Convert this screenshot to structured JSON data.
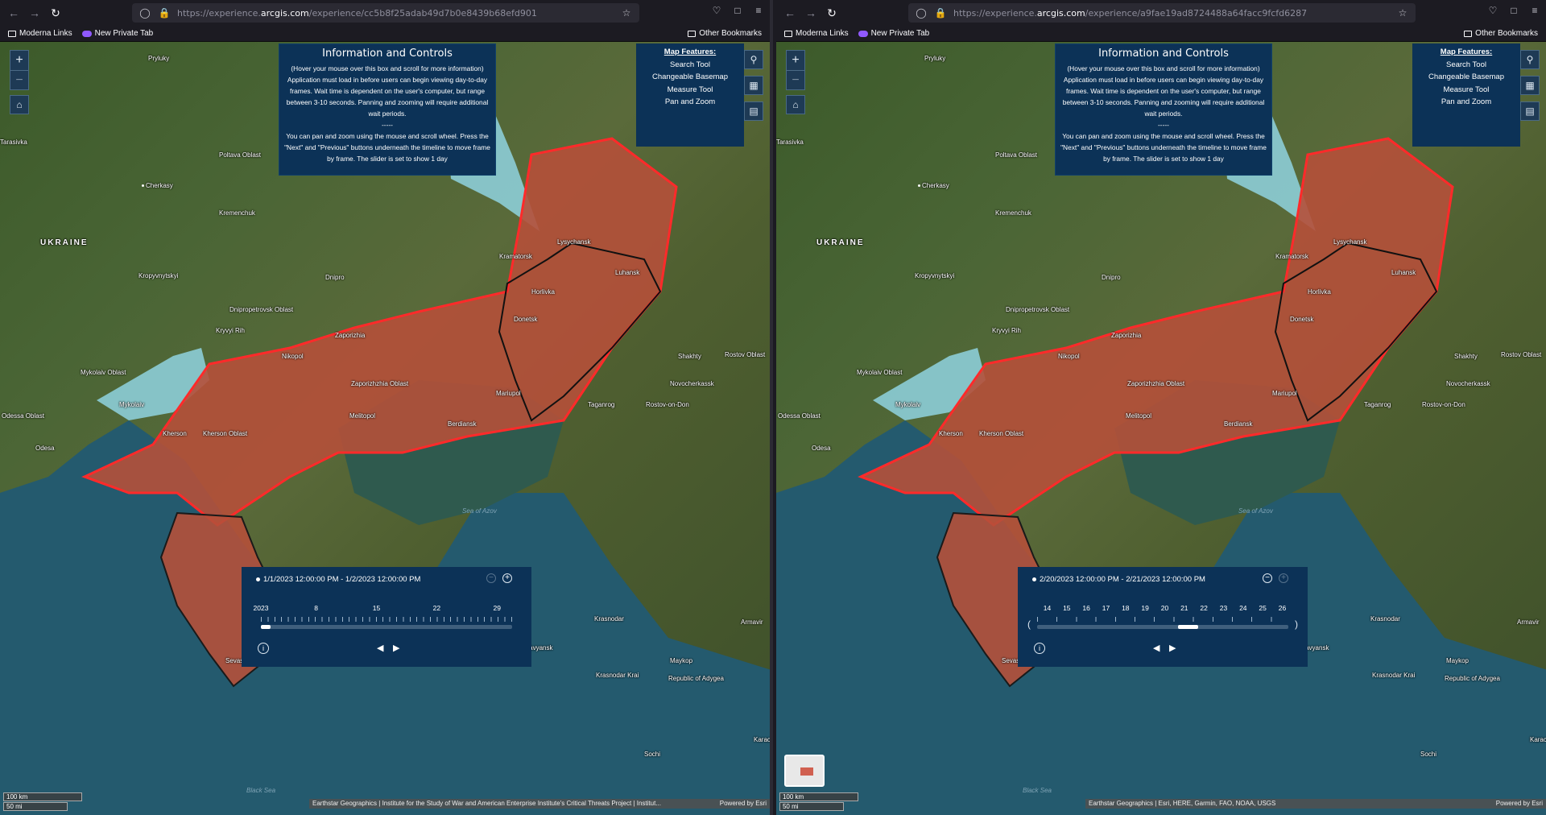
{
  "browser": {
    "bookmarks": [
      "Moderna Links",
      "New Private Tab"
    ],
    "other_bookmarks": "Other Bookmarks"
  },
  "panes": [
    {
      "url_host_prefix": "https://experience.",
      "url_host_bold": "arcgis.com",
      "url_path": "/experience/cc5b8f25adab49d7b0e8439b68efd901",
      "timeslider": {
        "range": "1/1/2023 12:00:00 PM - 1/2/2023 12:00:00 PM",
        "ticks": [
          "2023",
          "8",
          "15",
          "22",
          "29"
        ],
        "thumb_fraction": 0.0,
        "zoom_out_enabled": false,
        "zoom_in_enabled": true
      },
      "attribution": "Earthstar Geographics | Institute for the Study of War and American Enterprise Institute's Critical Threats Project | Institut...",
      "powered_by": "Powered by Esri"
    },
    {
      "url_host_prefix": "https://experience.",
      "url_host_bold": "arcgis.com",
      "url_path": "/experience/a9fae19ad8724488a64facc9fcfd6287",
      "timeslider": {
        "range": "2/20/2023 12:00:00 PM - 2/21/2023 12:00:00 PM",
        "ticks": [
          "14",
          "15",
          "16",
          "17",
          "18",
          "19",
          "20",
          "21",
          "22",
          "23",
          "24",
          "25",
          "26"
        ],
        "thumb_fraction": 0.56,
        "zoom_out_enabled": true,
        "zoom_in_enabled": false
      },
      "attribution": "Earthstar Geographics | Esri, HERE, Garmin, FAO, NOAA, USGS",
      "powered_by": "Powered by Esri"
    }
  ],
  "info_panel": {
    "title": "Information and Controls",
    "body": [
      "(Hover your mouse over this box and scroll for more information)",
      "Application must load in before users can begin viewing day-to-day frames. Wait time is dependent on the user's computer, but range between 3-10 seconds. Panning and zooming will require additional wait periods.",
      "-----",
      "You can pan and zoom using the mouse and scroll wheel. Press the \"Next\" and \"Previous\" buttons underneath the timeline to move frame by frame. The slider is set to show 1 day"
    ]
  },
  "features": {
    "heading": "Map Features:",
    "items": [
      "Search Tool",
      "Changeable Basemap",
      "Measure Tool",
      "Pan and Zoom"
    ]
  },
  "scale": {
    "km": "100 km",
    "mi": "50 mi"
  },
  "places": [
    "UKRAINE",
    "Cherkasy",
    "Kremenchuk",
    "Poltava Oblast",
    "Kropyvnytskyi",
    "Dnipro",
    "Dnipropetrovsk Oblast",
    "Kryvyi Rih",
    "Zaporizhia",
    "Nikopol",
    "Mykolaiv Oblast",
    "Mykolaiv",
    "Odessa Oblast",
    "Odesa",
    "Kherson",
    "Kherson Oblast",
    "Zaporizhzhia Oblast",
    "Melitopol",
    "Berdiansk",
    "Mariupol",
    "Donetsk",
    "Horlivka",
    "Kramatorsk",
    "Lysychansk",
    "Luhansk",
    "Shakhty",
    "Novocherkassk",
    "Rostov-on-Don",
    "Taganrog",
    "Rostov Oblast",
    "Sea of Azov",
    "Black Sea",
    "Sevastopol",
    "Krasnodar Krai",
    "Krasnodar",
    "Maykop",
    "Republic of Adygea",
    "Sochi",
    "Armavir",
    "Slavyansk",
    "Karachay",
    "Pryluky",
    "Tarasivka"
  ],
  "colors": {
    "occupied_fill": "#b5503a",
    "frontline": "#ff2a2a",
    "liberated_fill": "#8fd3e0",
    "panel_bg": "#0c3257",
    "sea": "#245a6e"
  }
}
